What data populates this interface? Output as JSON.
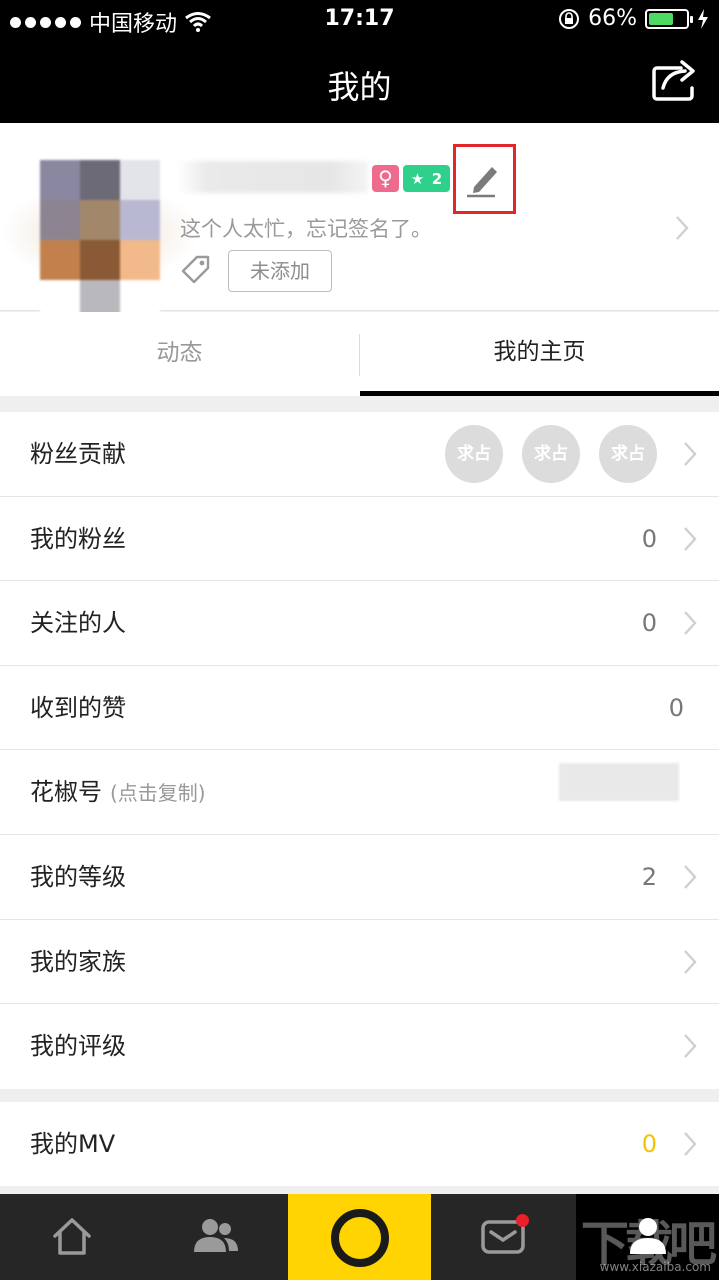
{
  "status_bar": {
    "carrier": "中国移动",
    "time": "17:17",
    "battery": "66%",
    "battery_level": 0.66
  },
  "nav": {
    "title": "我的"
  },
  "profile": {
    "signature": "这个人太忙，忘记签名了。",
    "gender_symbol": "♀",
    "level_badge": "2",
    "tag_button": "未添加"
  },
  "tabs": [
    {
      "label": "动态"
    },
    {
      "label": "我的主页"
    }
  ],
  "rows": [
    {
      "label": "粉丝贡献",
      "circles": [
        "求占",
        "求占",
        "求占"
      ]
    },
    {
      "label": "我的粉丝",
      "value": "0"
    },
    {
      "label": "关注的人",
      "value": "0"
    },
    {
      "label": "收到的赞",
      "value": "0"
    },
    {
      "label": "花椒号",
      "sub": "(点击复制)"
    },
    {
      "label": "我的等级",
      "value": "2"
    },
    {
      "label": "我的家族"
    },
    {
      "label": "我的评级"
    }
  ],
  "mv_row": {
    "label": "我的MV",
    "value": "0"
  },
  "watermark": {
    "text": "下载吧",
    "sub": "www.xiazaiba.com"
  }
}
